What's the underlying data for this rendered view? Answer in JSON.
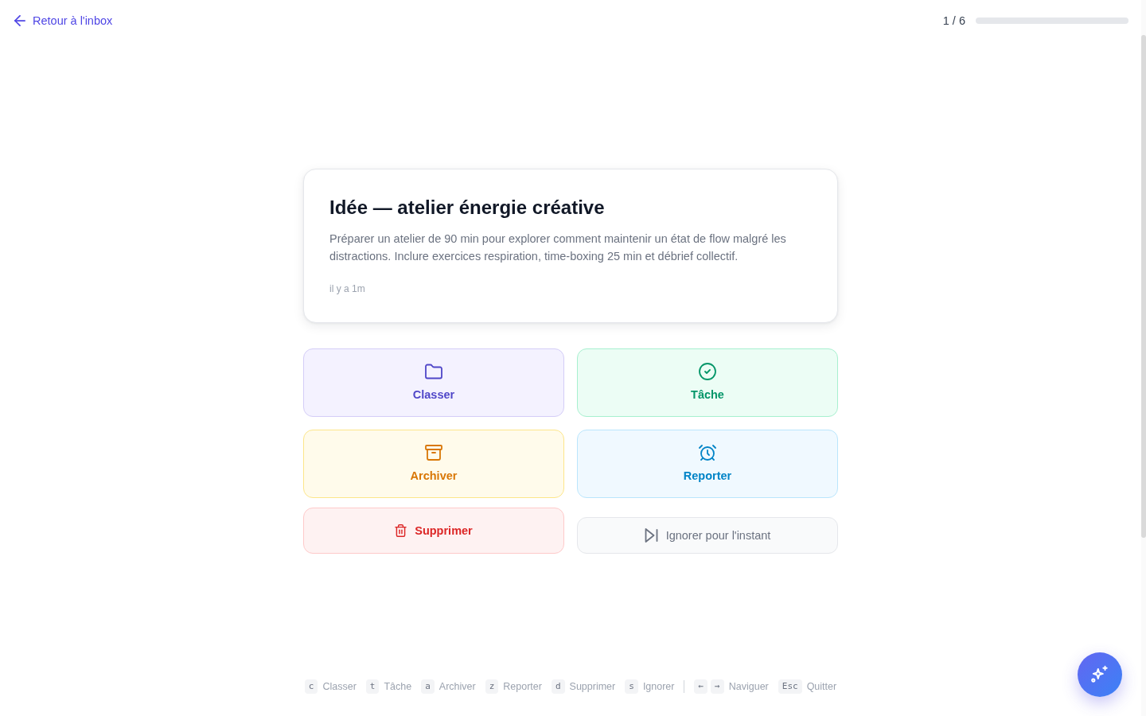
{
  "header": {
    "back_link": "Retour à l'inbox",
    "progress": {
      "text": "1 / 6"
    }
  },
  "card": {
    "title": "Idée — atelier énergie créative",
    "body": "Préparer un atelier de 90 min pour explorer comment maintenir un état de flow malgré les distractions. Inclure exercices respiration, time-boxing 25 min et débrief collectif.",
    "time": "il y a 1m"
  },
  "actions": [
    {
      "kind": "file",
      "label": "Classer"
    },
    {
      "kind": "task",
      "label": "Tâche"
    },
    {
      "kind": "archive",
      "label": "Archiver"
    },
    {
      "kind": "snooze",
      "label": "Reporter"
    }
  ],
  "secondary_actions": [
    {
      "kind": "delete",
      "label": "Supprimer"
    },
    {
      "kind": "skip",
      "label": "Ignorer pour l'instant"
    }
  ],
  "shortcut_groups": [
    [
      {
        "keys": [
          "c"
        ],
        "label": "Classer"
      },
      {
        "keys": [
          "t"
        ],
        "label": "Tâche"
      },
      {
        "keys": [
          "a"
        ],
        "label": "Archiver"
      },
      {
        "keys": [
          "z"
        ],
        "label": "Reporter"
      },
      {
        "keys": [
          "d"
        ],
        "label": "Supprimer"
      },
      {
        "keys": [
          "s"
        ],
        "label": "Ignorer"
      }
    ],
    [
      {
        "keys": [
          "←",
          "→"
        ],
        "label": "Naviguer"
      },
      {
        "keys": [
          "Esc"
        ],
        "label": "Quitter"
      }
    ]
  ]
}
